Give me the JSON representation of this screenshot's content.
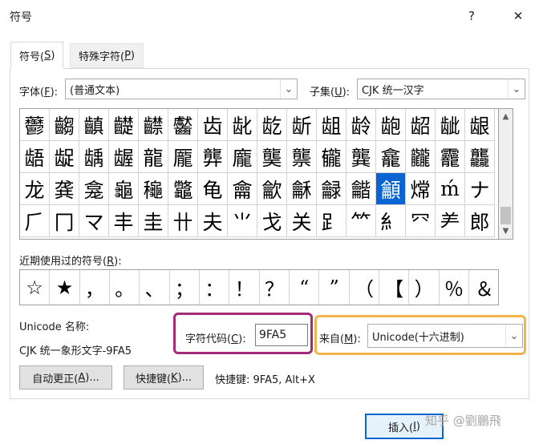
{
  "window": {
    "title": "符号",
    "help_glyph": "?",
    "close_glyph": "✕"
  },
  "tabs": [
    {
      "label": "符号(",
      "key": "S",
      "suffix": ")"
    },
    {
      "label": "特殊字符(",
      "key": "P",
      "suffix": ")"
    }
  ],
  "font": {
    "label": "字体(",
    "key": "F",
    "suffix": "):",
    "value": "(普通文本)"
  },
  "subset": {
    "label": "子集(",
    "key": "U",
    "suffix": "):",
    "value": "CJK 统一汉字"
  },
  "symbols": [
    "䖇",
    "齺",
    "齻",
    "齼",
    "齽",
    "齾",
    "齿",
    "龀",
    "龁",
    "龂",
    "龃",
    "龄",
    "龅",
    "龆",
    "龇",
    "龈",
    "龉",
    "龊",
    "龋",
    "龌",
    "龍",
    "龎",
    "龏",
    "龐",
    "龑",
    "龒",
    "龓",
    "龔",
    "龕",
    "龖",
    "龗",
    "龘",
    "龙",
    "龚",
    "龛",
    "龜",
    "龝",
    "龞",
    "龟",
    "龠",
    "龡",
    "龢",
    "龣",
    "龤",
    "龥",
    "龦",
    "ḿ",
    "ナ",
    "⺁",
    "冂",
    "マ",
    "丰",
    "圭",
    "卄",
    "夫",
    "⺌",
    "戈",
    "关",
    "⻊",
    "⺮",
    "⺯",
    "⺳",
    "⺶",
    "郎"
  ],
  "selected_index": 44,
  "recent": {
    "label": "近期使用过的符号(",
    "key": "R",
    "suffix": "):",
    "items": [
      "☆",
      "★",
      "，",
      "。",
      "、",
      "；",
      "：",
      "！",
      "？",
      "“",
      "”",
      "（",
      "【",
      "）",
      "％",
      "＆"
    ]
  },
  "unicode_name": {
    "label": "Unicode 名称:",
    "value": "CJK 统一象形文字-9FA5"
  },
  "char_code": {
    "label": "字符代码(",
    "key": "C",
    "suffix": "):",
    "value": "9FA5"
  },
  "from": {
    "label": "来自(",
    "key": "M",
    "suffix": "):",
    "value": "Unicode(十六进制)"
  },
  "buttons": {
    "autocorrect": {
      "label": "自动更正(",
      "key": "A",
      "suffix": ")..."
    },
    "shortcut_key": {
      "label": "快捷键(",
      "key": "K",
      "suffix": ")..."
    },
    "insert": {
      "label": "插入(",
      "key": "I",
      "suffix": ")"
    }
  },
  "shortcut_text": "快捷键: 9FA5, Alt+X",
  "watermark": "知乎 @劉鵬飛",
  "colors": {
    "selection": "#0a64d2",
    "highlight_code": "#a62a7a",
    "highlight_from": "#f2b54a"
  }
}
